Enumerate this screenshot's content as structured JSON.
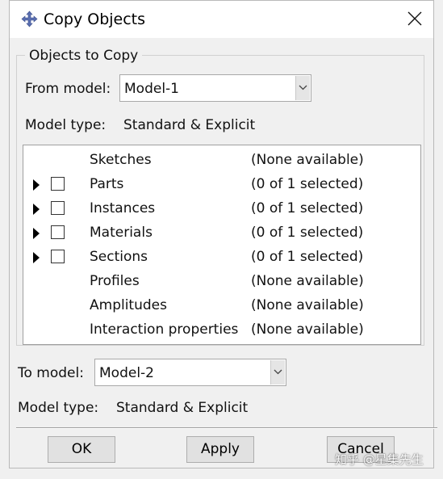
{
  "window": {
    "title": "Copy Objects",
    "app_icon": "abaqus-cross-icon",
    "close_icon": "close-x-icon"
  },
  "source": {
    "group_label": "Objects to Copy",
    "from_model_label": "From model:",
    "from_model_value": "Model-1",
    "model_type_label": "Model type:",
    "model_type_value": "Standard & Explicit",
    "objects": [
      {
        "name": "Sketches",
        "status": "(None available)",
        "expandable": false
      },
      {
        "name": "Parts",
        "status": "(0 of 1 selected)",
        "expandable": true
      },
      {
        "name": "Instances",
        "status": "(0 of 1 selected)",
        "expandable": true
      },
      {
        "name": "Materials",
        "status": "(0 of 1 selected)",
        "expandable": true
      },
      {
        "name": "Sections",
        "status": "(0 of 1 selected)",
        "expandable": true
      },
      {
        "name": "Profiles",
        "status": "(None available)",
        "expandable": false
      },
      {
        "name": "Amplitudes",
        "status": "(None available)",
        "expandable": false
      },
      {
        "name": "Interaction properties",
        "status": "(None available)",
        "expandable": false
      }
    ]
  },
  "target": {
    "to_model_label": "To model:",
    "to_model_value": "Model-2",
    "model_type_label": "Model type:",
    "model_type_value": "Standard & Explicit"
  },
  "buttons": {
    "ok": "OK",
    "apply": "Apply",
    "cancel": "Cancel"
  },
  "watermark": "知乎 @星集先生",
  "colors": {
    "dialog_bg": "#f0f0f0",
    "titlebar_bg": "#ffffff",
    "button_bg": "#e1e1e1",
    "icon_blue": "#5a6fb0"
  }
}
